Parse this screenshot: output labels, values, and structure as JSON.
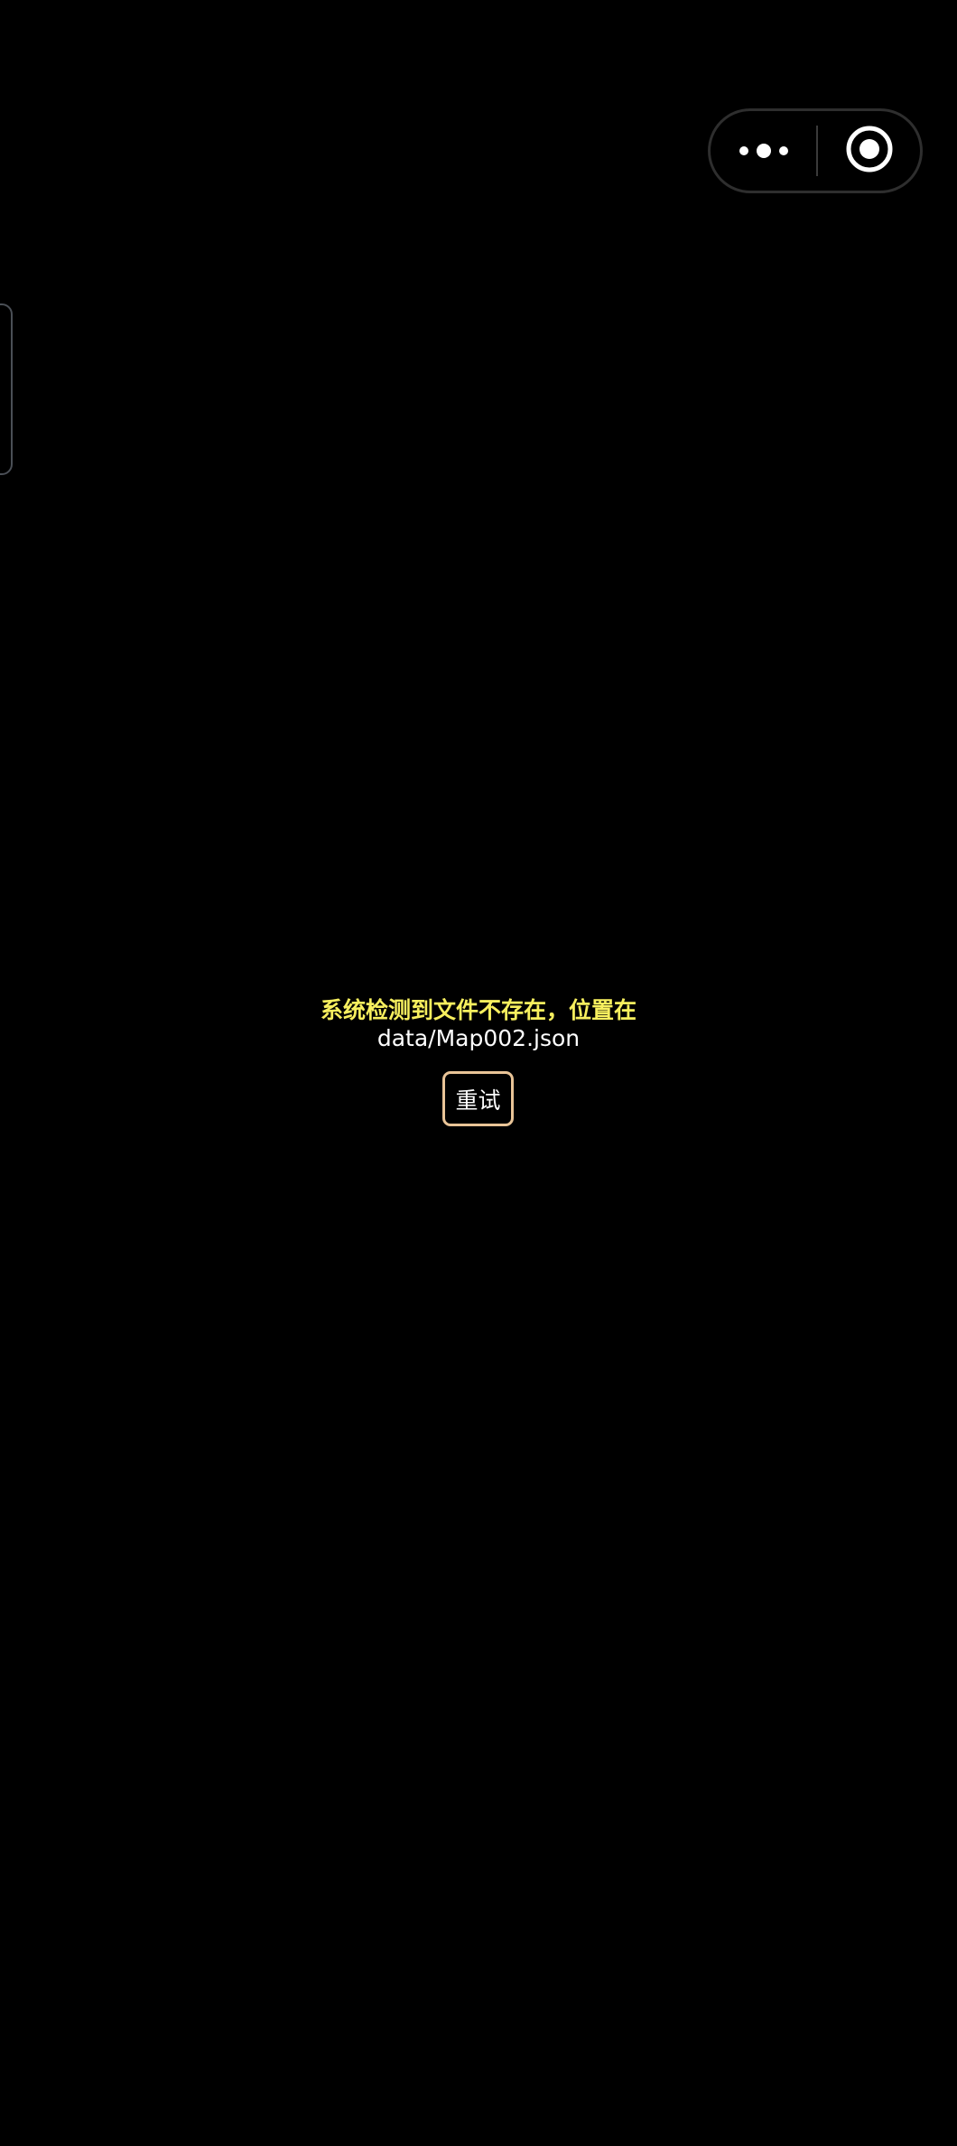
{
  "capsule": {
    "more_icon": "more-dots-icon",
    "close_icon": "target-circle-icon"
  },
  "error": {
    "title": "系统检测到文件不存在，位置在",
    "path": "data/Map002.json",
    "title_color": "#f7ef5e"
  },
  "retry": {
    "label": "重试",
    "border_color": "#e9c497"
  }
}
